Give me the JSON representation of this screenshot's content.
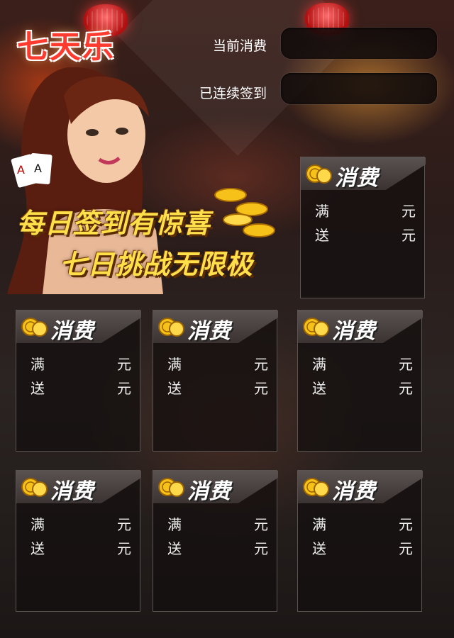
{
  "app": {
    "logo_text": "七天乐"
  },
  "info": {
    "current_spend_label": "当前消费",
    "current_spend_value": "",
    "consecutive_checkin_label": "已连续签到",
    "consecutive_checkin_value": ""
  },
  "banner": {
    "line1": "每日签到有惊喜",
    "line2": "七日挑战无限极"
  },
  "cards": [
    {
      "title": "消费",
      "threshold_label": "满",
      "threshold_unit": "元",
      "reward_label": "送",
      "reward_unit": "元"
    },
    {
      "title": "消费",
      "threshold_label": "满",
      "threshold_unit": "元",
      "reward_label": "送",
      "reward_unit": "元"
    },
    {
      "title": "消费",
      "threshold_label": "满",
      "threshold_unit": "元",
      "reward_label": "送",
      "reward_unit": "元"
    },
    {
      "title": "消费",
      "threshold_label": "满",
      "threshold_unit": "元",
      "reward_label": "送",
      "reward_unit": "元"
    },
    {
      "title": "消费",
      "threshold_label": "满",
      "threshold_unit": "元",
      "reward_label": "送",
      "reward_unit": "元"
    },
    {
      "title": "消费",
      "threshold_label": "满",
      "threshold_unit": "元",
      "reward_label": "送",
      "reward_unit": "元"
    },
    {
      "title": "消费",
      "threshold_label": "满",
      "threshold_unit": "元",
      "reward_label": "送",
      "reward_unit": "元"
    }
  ],
  "colors": {
    "accent_gold": "#ffe04a",
    "logo_red": "#ff3b2f",
    "card_bg": "#1a1414"
  }
}
